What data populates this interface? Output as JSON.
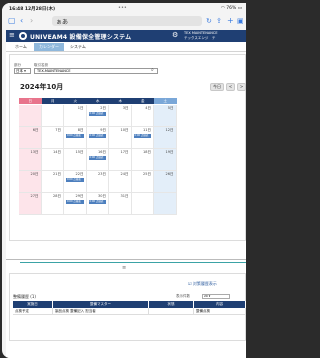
{
  "status_bar": {
    "time": "16:48",
    "date": "12月28日(木)",
    "dots": "•••",
    "battery": "76%"
  },
  "browser": {
    "reader_label": "ぁあ",
    "url": "",
    "back_icon": "chevron-left",
    "forward_icon": "chevron-right",
    "book_icon": "book",
    "reload_icon": "reload",
    "share_icon": "share",
    "add_icon": "plus",
    "tabs_icon": "tabs"
  },
  "app": {
    "title": "UNIVEAM4 設備保全管理システム",
    "user_line1": "TEX MAINTENANCE",
    "user_line2": "テックスエンジ　テ",
    "menu_icon": "menu-icon",
    "settings_icon": "gear-icon"
  },
  "tabs": [
    {
      "label": "ホーム",
      "active": false
    },
    {
      "label": "カレンダー",
      "active": true
    },
    {
      "label": "システム",
      "active": false
    }
  ],
  "filters": {
    "category_label": "部分",
    "category_value": "日本 ▾",
    "facility_label": "取引名設",
    "facility_value": "TEX-MAINTENANCE"
  },
  "calendar": {
    "month_title": "2024年10月",
    "today_label": "今日",
    "prev_label": "<",
    "next_label": ">",
    "weekdays": [
      "日",
      "月",
      "火",
      "水",
      "木",
      "金",
      "土"
    ],
    "weeks": [
      [
        {
          "day": "",
          "events": []
        },
        {
          "day": "",
          "events": []
        },
        {
          "day": "1日",
          "events": []
        },
        {
          "day": "2日",
          "events": [
            "0:00 点検表"
          ]
        },
        {
          "day": "3日",
          "events": []
        },
        {
          "day": "4日",
          "events": []
        },
        {
          "day": "5日",
          "events": []
        }
      ],
      [
        {
          "day": "6日",
          "events": []
        },
        {
          "day": "7日",
          "events": []
        },
        {
          "day": "8日",
          "events": [
            "0:00 点検表"
          ]
        },
        {
          "day": "9日",
          "events": [
            "0:00 点検表"
          ]
        },
        {
          "day": "10日",
          "events": []
        },
        {
          "day": "11日",
          "events": [
            "0:00 点検表"
          ]
        },
        {
          "day": "12日",
          "events": []
        }
      ],
      [
        {
          "day": "13日",
          "events": []
        },
        {
          "day": "14日",
          "events": []
        },
        {
          "day": "15日",
          "events": []
        },
        {
          "day": "16日",
          "events": [
            "0:00 点検表"
          ]
        },
        {
          "day": "17日",
          "events": []
        },
        {
          "day": "18日",
          "events": []
        },
        {
          "day": "19日",
          "events": []
        }
      ],
      [
        {
          "day": "20日",
          "events": []
        },
        {
          "day": "21日",
          "events": []
        },
        {
          "day": "22日",
          "events": [
            "0:00 点検表"
          ]
        },
        {
          "day": "23日",
          "events": []
        },
        {
          "day": "24日",
          "events": []
        },
        {
          "day": "25日",
          "events": []
        },
        {
          "day": "26日",
          "events": []
        }
      ],
      [
        {
          "day": "27日",
          "events": []
        },
        {
          "day": "28日",
          "events": []
        },
        {
          "day": "29日",
          "events": [
            "0:00 点検表"
          ]
        },
        {
          "day": "30日",
          "events": [
            "0:00 点検表"
          ]
        },
        {
          "day": "31日",
          "events": []
        },
        {
          "day": "",
          "events": []
        },
        {
          "day": "",
          "events": []
        }
      ]
    ]
  },
  "history": {
    "splitter_icon": "≡",
    "add_button": "☑ 対策履歴表示",
    "title": "整備履歴 (1)",
    "pager_label": "表示件数",
    "pager_value": "20 ▾",
    "columns": [
      "実施日",
      "整備マスター",
      "状態",
      "内容"
    ],
    "rows": [
      [
        "点検予定",
        "製品点検 整備記入 担当者",
        "",
        "整備点検"
      ]
    ]
  },
  "colors": {
    "header_navy": "#1f3f73",
    "accent_blue": "#4d7fbe",
    "tab_active": "#8fb8dc",
    "sunday": "#e8748c",
    "saturday": "#7aa7d8",
    "weekday_header": "#1f3f73"
  }
}
